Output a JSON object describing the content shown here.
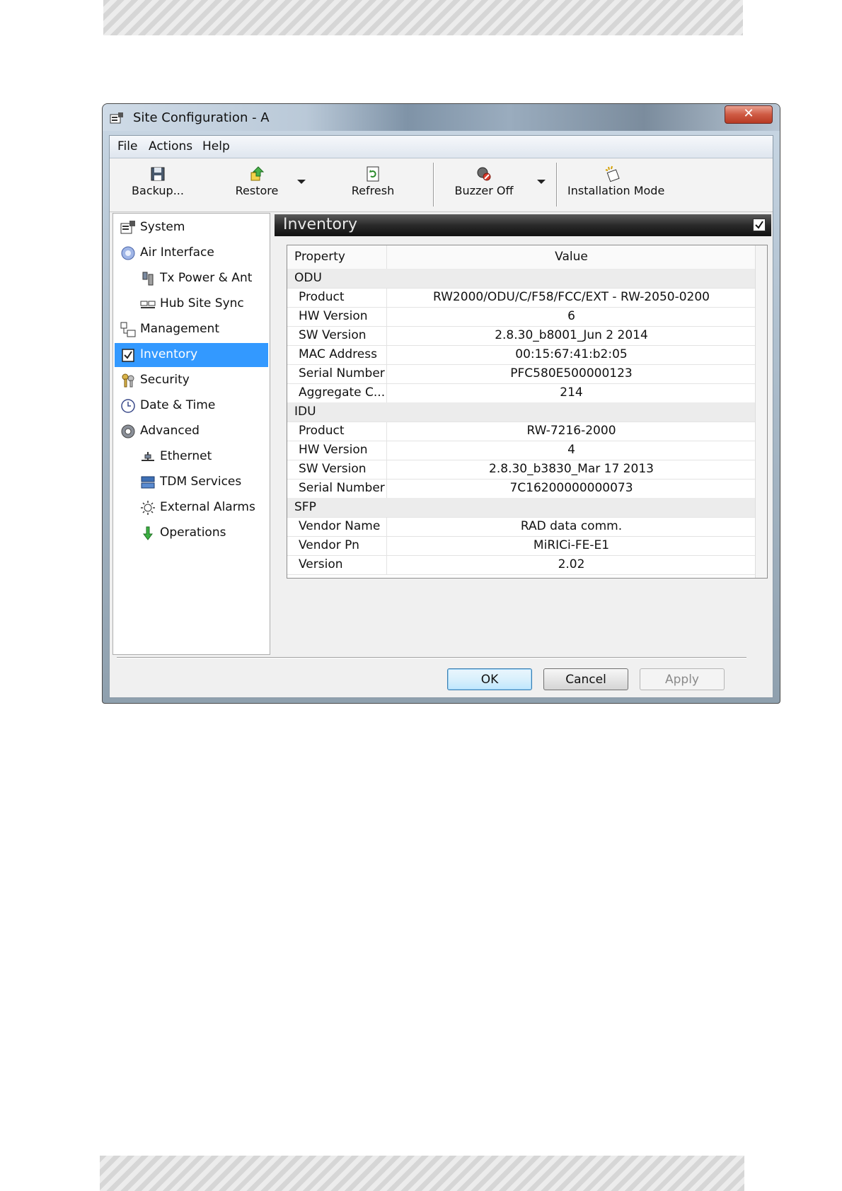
{
  "window": {
    "title": "Site Configuration - A",
    "close_glyph": "✕"
  },
  "menubar": {
    "items": [
      "File",
      "Actions",
      "Help"
    ]
  },
  "toolbar": {
    "backup": "Backup...",
    "restore": "Restore",
    "refresh": "Refresh",
    "buzzer_off": "Buzzer Off",
    "installation_mode": "Installation Mode"
  },
  "nav": {
    "items": [
      {
        "label": "System",
        "icon": "system-config-icon"
      },
      {
        "label": "Air Interface",
        "icon": "air-interface-icon"
      },
      {
        "label": "Tx Power & Ant",
        "icon": "tx-power-antenna-icon"
      },
      {
        "label": "Hub Site Sync",
        "icon": "hub-sync-icon"
      },
      {
        "label": "Management",
        "icon": "management-icon"
      },
      {
        "label": "Inventory",
        "icon": "inventory-check-icon",
        "selected": true
      },
      {
        "label": "Security",
        "icon": "security-keys-icon"
      },
      {
        "label": "Date & Time",
        "icon": "clock-icon"
      },
      {
        "label": "Advanced",
        "icon": "gear-icon"
      },
      {
        "label": "Ethernet",
        "icon": "ethernet-icon"
      },
      {
        "label": "TDM Services",
        "icon": "tdm-services-icon"
      },
      {
        "label": "External Alarms",
        "icon": "alarm-icon"
      },
      {
        "label": "Operations",
        "icon": "operations-arrow-icon"
      }
    ]
  },
  "panel": {
    "title": "Inventory"
  },
  "grid": {
    "headers": {
      "property": "Property",
      "value": "Value"
    },
    "rows": [
      {
        "group": "ODU"
      },
      {
        "property": "Product",
        "value": "RW2000/ODU/C/F58/FCC/EXT - RW-2050-0200"
      },
      {
        "property": "HW Version",
        "value": "6"
      },
      {
        "property": "SW Version",
        "value": "2.8.30_b8001_Jun  2 2014"
      },
      {
        "property": "MAC Address",
        "value": "00:15:67:41:b2:05"
      },
      {
        "property": "Serial Number",
        "value": "PFC580E500000123"
      },
      {
        "property": "Aggregate C...",
        "value": "214"
      },
      {
        "group": "IDU"
      },
      {
        "property": "Product",
        "value": "RW-7216-2000"
      },
      {
        "property": "HW Version",
        "value": "4"
      },
      {
        "property": "SW Version",
        "value": "2.8.30_b3830_Mar 17 2013"
      },
      {
        "property": "Serial Number",
        "value": "7C16200000000073"
      },
      {
        "group": "SFP"
      },
      {
        "property": "Vendor Name",
        "value": "RAD data comm."
      },
      {
        "property": "Vendor Pn",
        "value": "MiRICi-FE-E1"
      },
      {
        "property": "Version",
        "value": "2.02"
      }
    ]
  },
  "footer": {
    "ok": "OK",
    "cancel": "Cancel",
    "apply": "Apply"
  }
}
